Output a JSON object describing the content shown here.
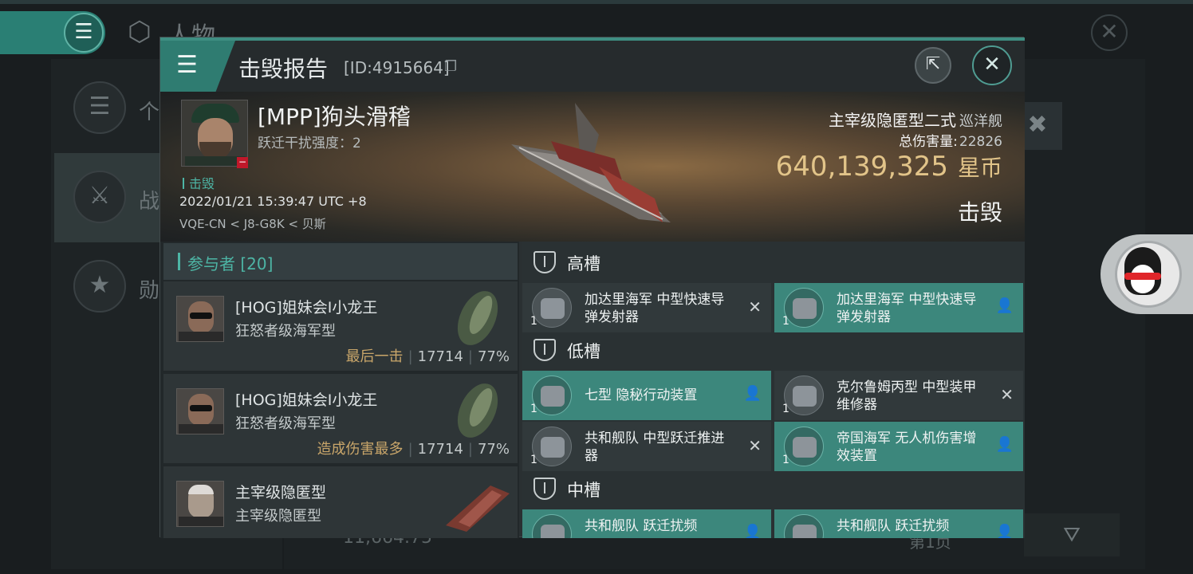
{
  "background": {
    "page_title": "人物",
    "sidebar": [
      {
        "label": "个",
        "icon": "list-icon"
      },
      {
        "label": "战",
        "icon": "crossed-swords-icon"
      },
      {
        "label": "勋",
        "icon": "star-badge-icon"
      }
    ],
    "bottom_amount": "11,664.75",
    "bottom_page": "第1页"
  },
  "dialog": {
    "title": "击毁报告",
    "report_id": "[ID:4915664]"
  },
  "victim": {
    "name": "[MPP]狗头滑稽",
    "warp_disruption": "跃迁干扰强度：2",
    "status": "击毁",
    "datetime": "2022/01/21 15:39:47 UTC +8",
    "location": "VQE-CN < J8-G8K < 贝斯",
    "ship_name": "主宰级隐匿型二式",
    "ship_class": "巡洋舰",
    "total_damage_label": "总伤害量:",
    "total_damage": "22826",
    "isk_value": "640,139,325",
    "isk_unit": "星币",
    "result": "击毁"
  },
  "participants": {
    "header": "参与者 [20]",
    "rows": [
      {
        "name": "[HOG]姐妹会I小龙王",
        "ship": "狂怒者级海军型",
        "tag": "最后一击",
        "damage": "17714",
        "percent": "77%"
      },
      {
        "name": "[HOG]姐妹会I小龙王",
        "ship": "狂怒者级海军型",
        "tag": "造成伤害最多",
        "damage": "17714",
        "percent": "77%"
      },
      {
        "name": "主宰级隐匿型",
        "ship": "主宰级隐匿型",
        "tag": "",
        "damage": "",
        "percent": ""
      }
    ]
  },
  "fittings": {
    "high_label": "高槽",
    "low_label": "低槽",
    "mid_label": "中槽",
    "high": [
      {
        "name": "加达里海军 中型快速导弹发射器",
        "qty": "1",
        "status": "destroyed"
      },
      {
        "name": "加达里海军 中型快速导弹发射器",
        "qty": "1",
        "status": "dropped"
      }
    ],
    "low": [
      {
        "name": "七型 隐秘行动装置",
        "qty": "1",
        "status": "dropped"
      },
      {
        "name": "克尔鲁姆丙型 中型装甲维修器",
        "qty": "1",
        "status": "destroyed"
      },
      {
        "name": "共和舰队 中型跃迁推进器",
        "qty": "1",
        "status": "destroyed"
      },
      {
        "name": "帝国海军 无人机伤害增效装置",
        "qty": "1",
        "status": "dropped"
      }
    ],
    "mid": [
      {
        "name": "共和舰队 跃迁扰频",
        "qty": "",
        "status": "dropped"
      },
      {
        "name": "共和舰队 跃迁扰频",
        "qty": "",
        "status": "dropped"
      }
    ]
  }
}
